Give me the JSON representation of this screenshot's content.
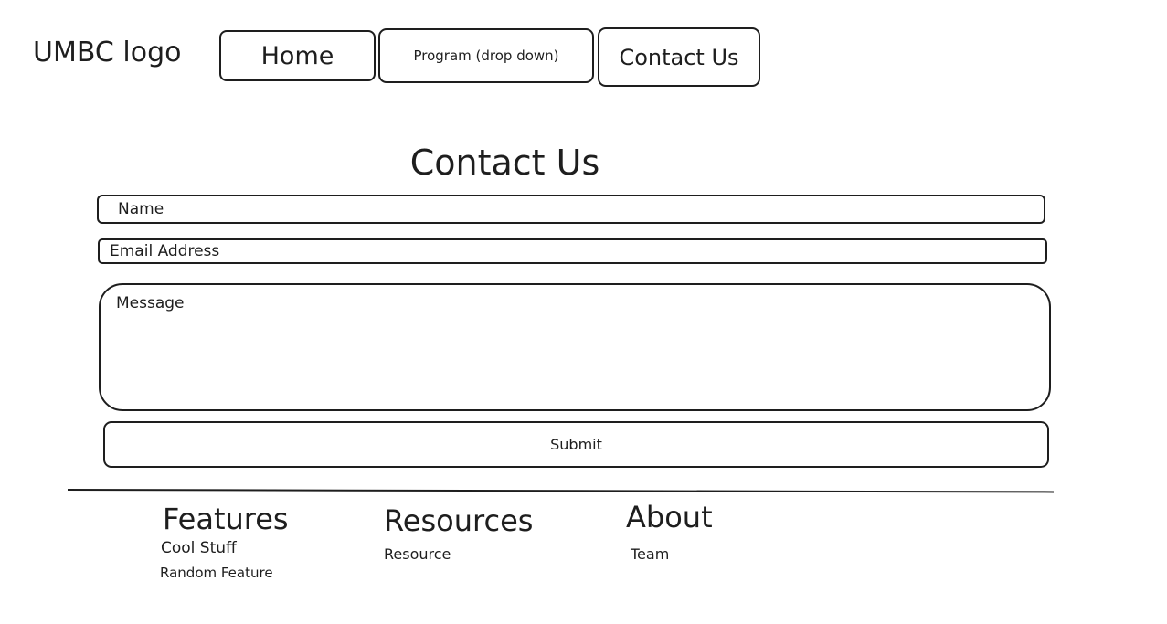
{
  "header": {
    "logo_text": "UMBC logo",
    "nav": {
      "home": "Home",
      "program": "Program (drop down)",
      "contact": "Contact Us"
    }
  },
  "contact_form": {
    "title": "Contact Us",
    "name_placeholder": "Name",
    "email_placeholder": "Email Address",
    "message_placeholder": "Message",
    "submit_label": "Submit"
  },
  "footer": {
    "features": {
      "heading": "Features",
      "links": [
        "Cool Stuff",
        "Random Feature"
      ]
    },
    "resources": {
      "heading": "Resources",
      "links": [
        "Resource"
      ]
    },
    "about": {
      "heading": "About",
      "links": [
        "Team"
      ]
    }
  }
}
